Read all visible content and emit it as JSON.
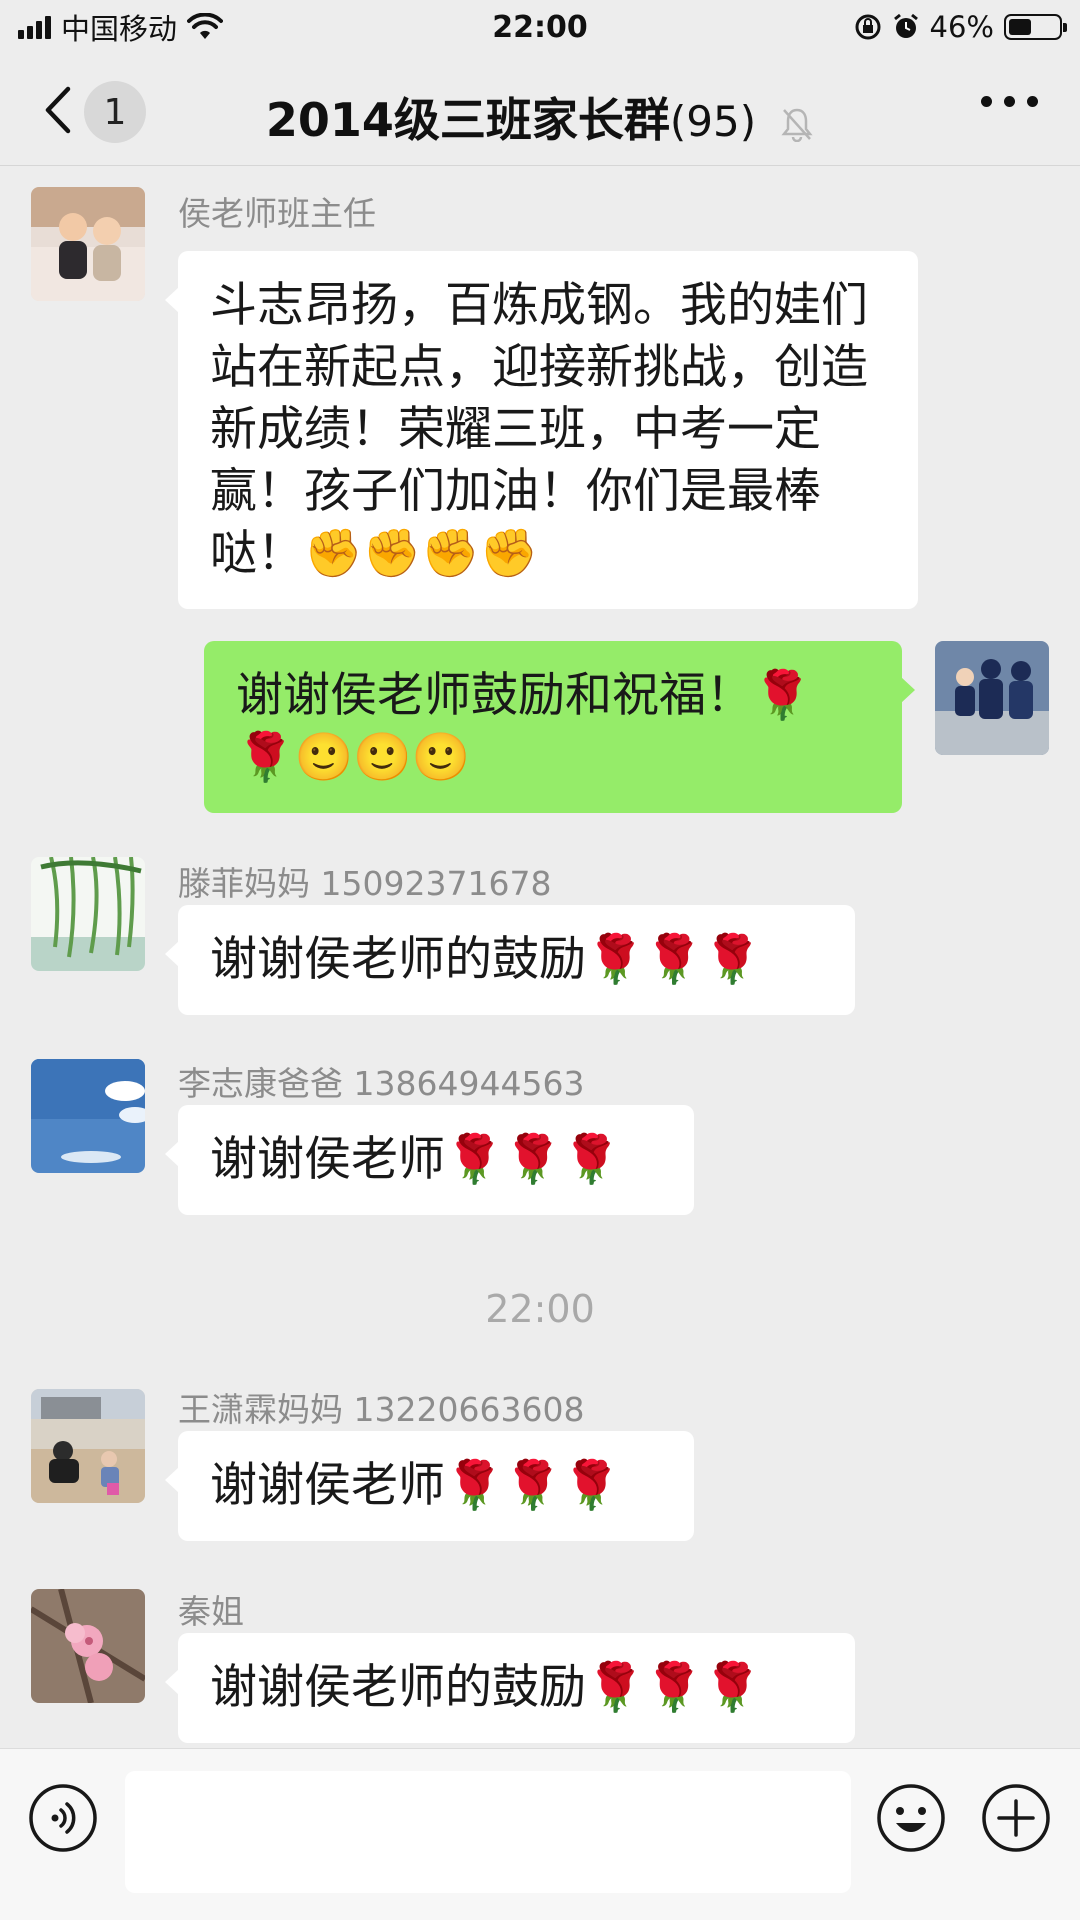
{
  "status_bar": {
    "carrier": "中国移动",
    "time": "22:00",
    "battery": "46%",
    "battery_level": 0.46
  },
  "nav": {
    "unread_count": "1",
    "title": "2014级三班家长群",
    "member_count": "(95)"
  },
  "messages": [
    {
      "sender": "侯老师班主任",
      "text": "斗志昂扬，百炼成钢。我的娃们站在新起点，迎接新挑战，创造新成绩！荣耀三班，中考一定赢！孩子们加油！你们是最棒哒！✊✊✊✊",
      "mine": false
    },
    {
      "sender": "",
      "text": "谢谢侯老师鼓励和祝福！🌹🌹🙂🙂🙂",
      "mine": true
    },
    {
      "sender": "滕菲妈妈 15092371678",
      "text": "谢谢侯老师的鼓励🌹🌹🌹",
      "mine": false
    },
    {
      "sender": "李志康爸爸 13864944563",
      "text": "谢谢侯老师🌹🌹🌹",
      "mine": false
    },
    {
      "sender": "王潇霖妈妈 13220663608",
      "text": "谢谢侯老师🌹🌹🌹",
      "mine": false
    },
    {
      "sender": "秦姐",
      "text": "谢谢侯老师的鼓励🌹🌹🌹",
      "mine": false
    }
  ],
  "timestamp": "22:00",
  "input_bar": {
    "value": "",
    "icons": [
      "voice-icon",
      "emoji-icon",
      "plus-icon"
    ]
  },
  "colors": {
    "background": "#ededed",
    "my_bubble": "#95ec69",
    "other_bubble": "#ffffff",
    "sender_name": "#8c8c8c"
  }
}
